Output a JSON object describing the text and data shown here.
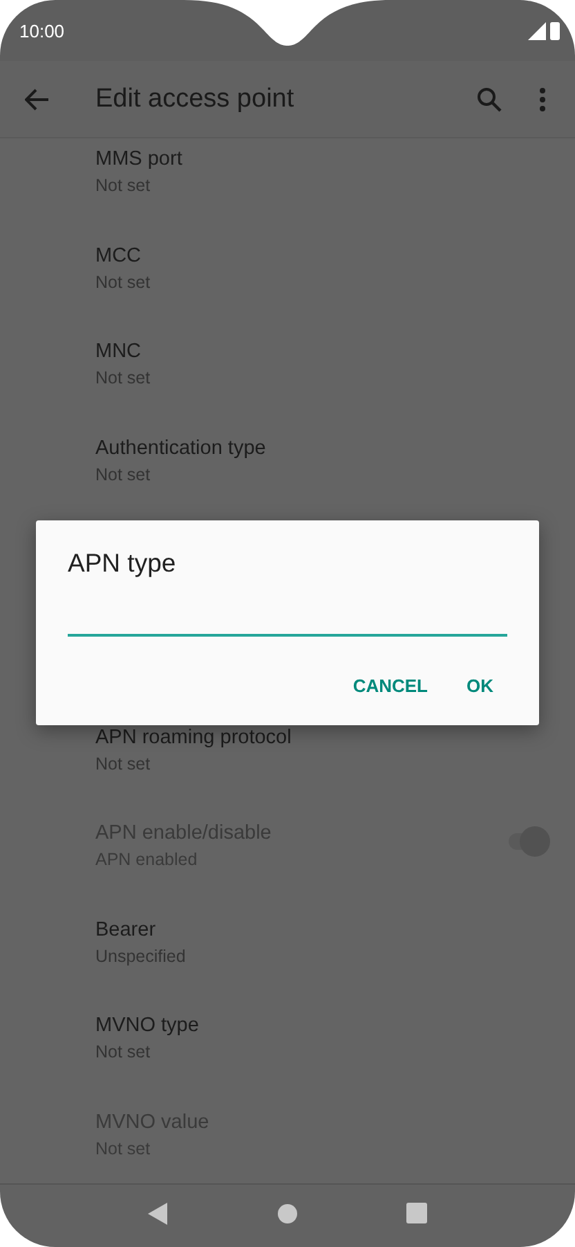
{
  "status_bar": {
    "time": "10:00"
  },
  "app_bar": {
    "title": "Edit access point"
  },
  "settings_above": [
    {
      "title": "MMS port",
      "summary": "Not set",
      "disabled": false
    },
    {
      "title": "MCC",
      "summary": "Not set",
      "disabled": false
    },
    {
      "title": "MNC",
      "summary": "Not set",
      "disabled": false
    },
    {
      "title": "Authentication type",
      "summary": "Not set",
      "disabled": false
    }
  ],
  "settings_below": [
    {
      "kind": "text",
      "title": "APN roaming protocol",
      "summary": "Not set",
      "disabled": false
    },
    {
      "kind": "switch",
      "title": "APN enable/disable",
      "summary": "APN enabled",
      "disabled": true,
      "on": true
    },
    {
      "kind": "text",
      "title": "Bearer",
      "summary": "Unspecified",
      "disabled": false
    },
    {
      "kind": "text",
      "title": "MVNO type",
      "summary": "Not set",
      "disabled": false
    },
    {
      "kind": "text",
      "title": "MVNO value",
      "summary": "Not set",
      "disabled": true
    }
  ],
  "dialog": {
    "title": "APN type",
    "buttons": [
      "CANCEL",
      "OK"
    ]
  }
}
